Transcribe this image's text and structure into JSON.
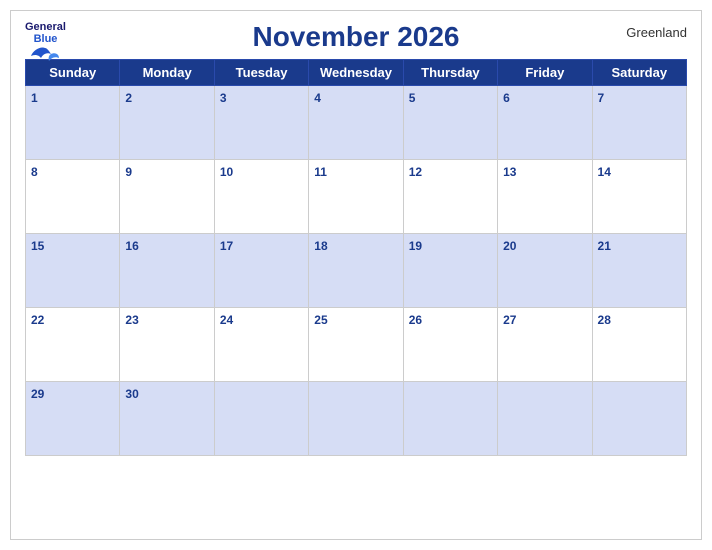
{
  "header": {
    "logo_general": "General",
    "logo_blue": "Blue",
    "title": "November 2026",
    "region": "Greenland"
  },
  "days_of_week": [
    "Sunday",
    "Monday",
    "Tuesday",
    "Wednesday",
    "Thursday",
    "Friday",
    "Saturday"
  ],
  "weeks": [
    [
      {
        "num": "1",
        "empty": false
      },
      {
        "num": "2",
        "empty": false
      },
      {
        "num": "3",
        "empty": false
      },
      {
        "num": "4",
        "empty": false
      },
      {
        "num": "5",
        "empty": false
      },
      {
        "num": "6",
        "empty": false
      },
      {
        "num": "7",
        "empty": false
      }
    ],
    [
      {
        "num": "8",
        "empty": false
      },
      {
        "num": "9",
        "empty": false
      },
      {
        "num": "10",
        "empty": false
      },
      {
        "num": "11",
        "empty": false
      },
      {
        "num": "12",
        "empty": false
      },
      {
        "num": "13",
        "empty": false
      },
      {
        "num": "14",
        "empty": false
      }
    ],
    [
      {
        "num": "15",
        "empty": false
      },
      {
        "num": "16",
        "empty": false
      },
      {
        "num": "17",
        "empty": false
      },
      {
        "num": "18",
        "empty": false
      },
      {
        "num": "19",
        "empty": false
      },
      {
        "num": "20",
        "empty": false
      },
      {
        "num": "21",
        "empty": false
      }
    ],
    [
      {
        "num": "22",
        "empty": false
      },
      {
        "num": "23",
        "empty": false
      },
      {
        "num": "24",
        "empty": false
      },
      {
        "num": "25",
        "empty": false
      },
      {
        "num": "26",
        "empty": false
      },
      {
        "num": "27",
        "empty": false
      },
      {
        "num": "28",
        "empty": false
      }
    ],
    [
      {
        "num": "29",
        "empty": false
      },
      {
        "num": "30",
        "empty": false
      },
      {
        "num": "",
        "empty": true
      },
      {
        "num": "",
        "empty": true
      },
      {
        "num": "",
        "empty": true
      },
      {
        "num": "",
        "empty": true
      },
      {
        "num": "",
        "empty": true
      }
    ]
  ]
}
